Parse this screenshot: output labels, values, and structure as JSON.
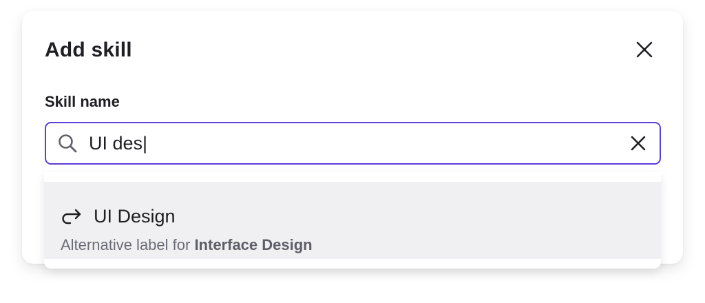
{
  "modal": {
    "title": "Add skill",
    "close_icon": "close-icon"
  },
  "form": {
    "field_label": "Skill name",
    "search_icon": "search-icon",
    "input_value": "UI des|",
    "clear_icon": "clear-icon"
  },
  "suggestions": [
    {
      "icon": "redirect-arrow-icon",
      "label": "UI Design",
      "sub_prefix": "Alternative label for ",
      "sub_target": "Interface Design"
    }
  ],
  "colors": {
    "accent": "#5b3fd6",
    "highlight_bg": "#f0f0f2",
    "text_primary": "#1e1e23",
    "text_secondary": "#6c6c76"
  }
}
